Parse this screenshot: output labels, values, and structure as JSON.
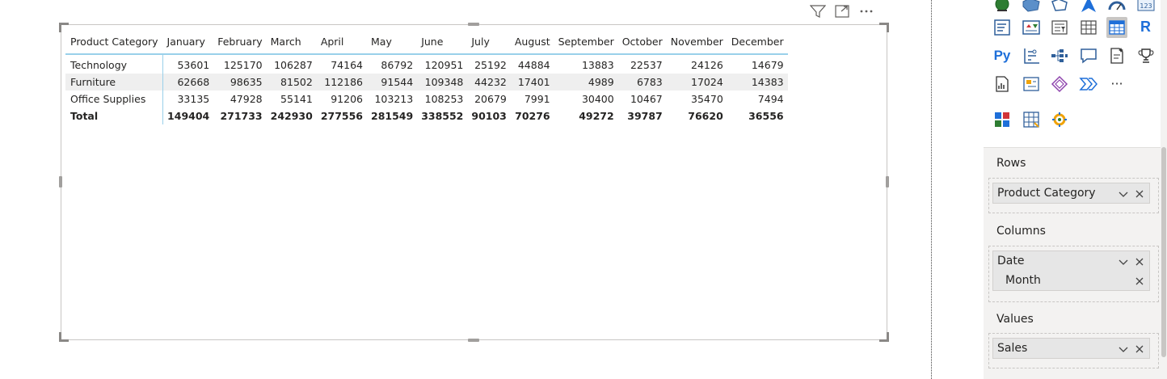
{
  "visual_toolbar": {
    "icons": [
      "filter-icon",
      "focus-mode-icon",
      "more-options-icon"
    ]
  },
  "matrix": {
    "row_header": "Product Category",
    "columns": [
      "January",
      "February",
      "March",
      "April",
      "May",
      "June",
      "July",
      "August",
      "September",
      "October",
      "November",
      "December"
    ],
    "rows": [
      {
        "label": "Technology",
        "values": [
          "53601",
          "125170",
          "106287",
          "74164",
          "86792",
          "120951",
          "25192",
          "44884",
          "13883",
          "22537",
          "24126",
          "14679"
        ]
      },
      {
        "label": "Furniture",
        "values": [
          "62668",
          "98635",
          "81502",
          "112186",
          "91544",
          "109348",
          "44232",
          "17401",
          "4989",
          "6783",
          "17024",
          "14383"
        ]
      },
      {
        "label": "Office Supplies",
        "values": [
          "33135",
          "47928",
          "55141",
          "91206",
          "103213",
          "108253",
          "20679",
          "7991",
          "30400",
          "10467",
          "35470",
          "7494"
        ]
      }
    ],
    "total": {
      "label": "Total",
      "values": [
        "149404",
        "271733",
        "242930",
        "277556",
        "281549",
        "338552",
        "90103",
        "70276",
        "49272",
        "39787",
        "76620",
        "36556"
      ]
    }
  },
  "visualizations": {
    "r_label": "R",
    "py_label": "Py",
    "more": "···"
  },
  "wells": {
    "rows": {
      "title": "Rows",
      "fields": [
        "Product Category"
      ]
    },
    "columns": {
      "title": "Columns",
      "field": "Date",
      "subfield": "Month"
    },
    "values": {
      "title": "Values",
      "fields": [
        "Sales"
      ]
    }
  },
  "colors": {
    "accent_line": "#99d0ea",
    "selected_viz": "#c8c6c4",
    "panel_bg": "#f3f2f1"
  }
}
